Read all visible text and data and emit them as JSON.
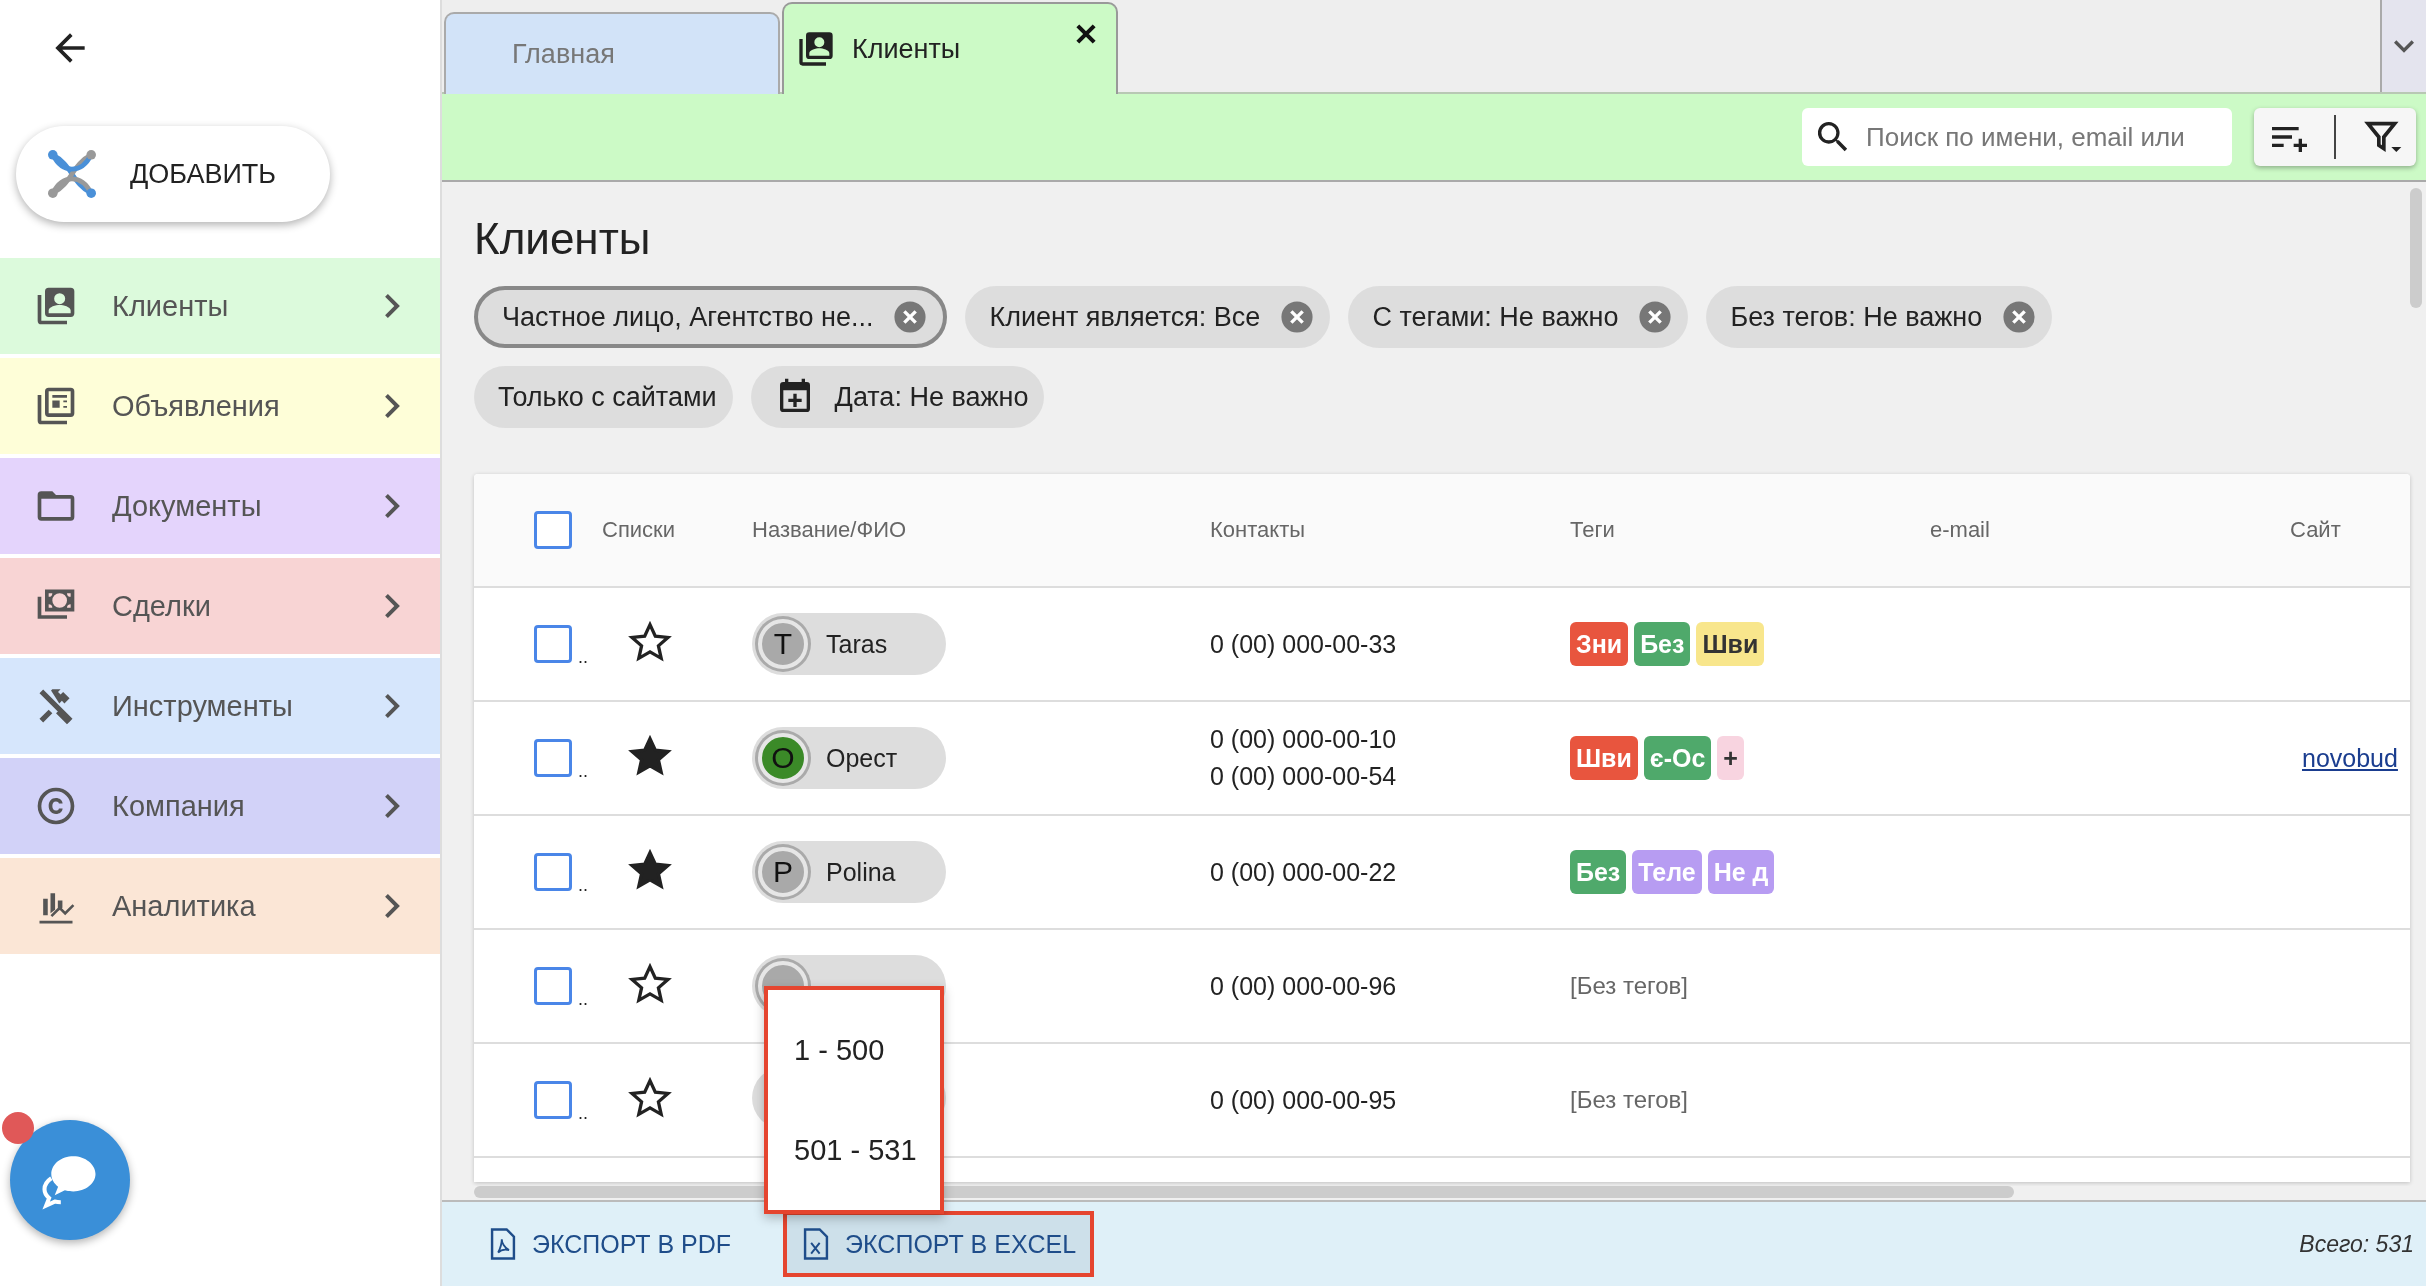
{
  "sidebar": {
    "add_button": "ДОБАВИТЬ",
    "items": [
      {
        "label": "Клиенты",
        "color": "#dcfadc"
      },
      {
        "label": "Объявления",
        "color": "#fefed8"
      },
      {
        "label": "Документы",
        "color": "#e4d4fc"
      },
      {
        "label": "Сделки",
        "color": "#f8d4d4"
      },
      {
        "label": "Инструменты",
        "color": "#d6e6fc"
      },
      {
        "label": "Компания",
        "color": "#d2d2f8"
      },
      {
        "label": "Аналитика",
        "color": "#fbe6d6"
      }
    ]
  },
  "tabs": [
    {
      "label": "Главная",
      "selected": false
    },
    {
      "label": "Клиенты",
      "selected": true
    }
  ],
  "search": {
    "placeholder": "Поиск по имени, email или"
  },
  "page_title": "Клиенты",
  "chips": [
    {
      "kind": "filter",
      "label": "Частное лицо, Агентство не...",
      "outlined": true
    },
    {
      "kind": "filter",
      "label": "Клиент является: Все",
      "outlined": false
    },
    {
      "kind": "filter",
      "label": "С тегами: Не важно",
      "outlined": false
    },
    {
      "kind": "filter",
      "label": "Без тегов: Не важно",
      "outlined": false
    },
    {
      "kind": "plain",
      "label": "Только с сайтами",
      "outlined": false
    },
    {
      "kind": "date",
      "label": "Дата: Не важно",
      "outlined": false
    }
  ],
  "table": {
    "header_checked": false,
    "columns": [
      "Списки",
      "Название/ФИО",
      "Контакты",
      "Теги",
      "e-mail",
      "Сайт"
    ],
    "rows": [
      {
        "checked": false,
        "lists": "..",
        "favorite": false,
        "avatar": {
          "letter": "T",
          "color": "#a9a9a9"
        },
        "name": "Taras",
        "phones": [
          "0 (00) 000-00-33"
        ],
        "tags": [
          {
            "label": "Зни",
            "color": "#e8553e"
          },
          {
            "label": "Без",
            "color": "#4fa96b"
          },
          {
            "label": "Шви",
            "color": "#f8e68c"
          }
        ]
      },
      {
        "checked": false,
        "lists": "..",
        "favorite": true,
        "avatar": {
          "letter": "О",
          "color": "#3b8a28"
        },
        "name": "Орест",
        "phones": [
          "0 (00) 000-00-10",
          "0 (00) 000-00-54"
        ],
        "tags": [
          {
            "label": "Шви",
            "color": "#e8553e"
          },
          {
            "label": "є-Ос",
            "color": "#4fa96b"
          },
          {
            "label": "+",
            "color": "#f8d4e0"
          }
        ],
        "site": "novobud"
      },
      {
        "checked": false,
        "lists": "..",
        "favorite": true,
        "avatar": {
          "letter": "P",
          "color": "#a9a9a9"
        },
        "name": "Polina",
        "phones": [
          "0 (00) 000-00-22"
        ],
        "tags": [
          {
            "label": "Без",
            "color": "#4fa96b"
          },
          {
            "label": "Теле",
            "color": "#b79cf2"
          },
          {
            "label": "Не д",
            "color": "#b79cf2"
          }
        ]
      },
      {
        "checked": false,
        "lists": "..",
        "favorite": false,
        "avatar": {
          "color": "#a9a9a9"
        },
        "phones": [
          "0 (00) 000-00-96"
        ],
        "no_tags": "[Без тегов]"
      },
      {
        "checked": false,
        "lists": "..",
        "favorite": false,
        "phones": [
          "0 (00) 000-00-95"
        ],
        "no_tags": "[Без тегов]"
      }
    ]
  },
  "export_menu": [
    "1 - 500",
    "501 - 531"
  ],
  "footer": {
    "buttons": [
      {
        "label": "ЭКСПОРТ В PDF",
        "kind": "pdf",
        "highlighted": false
      },
      {
        "label": "ЭКСПОРТ В EXCEL",
        "kind": "excel",
        "highlighted": true
      }
    ],
    "total": "Всего: 531"
  }
}
